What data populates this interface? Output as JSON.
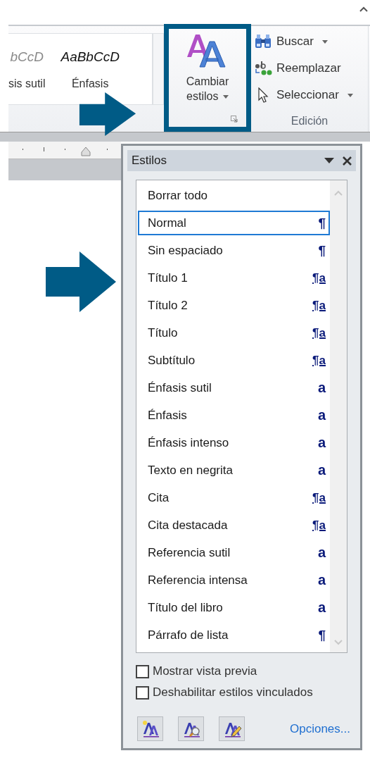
{
  "ribbon": {
    "gallery": [
      {
        "preview": "bCcD",
        "label": "sis sutil",
        "kind": "subtle"
      },
      {
        "preview": "AaBbCcD",
        "label": "Énfasis",
        "kind": "emphasis"
      }
    ],
    "change_styles": {
      "label": "Cambiar estilos",
      "highlighted": true
    },
    "editing": {
      "commands": [
        {
          "kind": "find",
          "label": "Buscar",
          "dropdown": true
        },
        {
          "kind": "replace",
          "label": "Reemplazar",
          "dropdown": false
        },
        {
          "kind": "select",
          "label": "Seleccionar",
          "dropdown": true
        }
      ],
      "group_label": "Edición"
    }
  },
  "styles_pane": {
    "title": "Estilos",
    "styles": [
      {
        "name": "Borrar todo",
        "selected": false
      },
      {
        "name": "Normal",
        "selected": true,
        "kind": "paragraph",
        "mark": "¶"
      },
      {
        "name": "Sin espaciado",
        "selected": false,
        "kind": "paragraph",
        "mark": "¶"
      },
      {
        "name": "Título 1",
        "selected": false,
        "kind": "linked",
        "mark": "¶a"
      },
      {
        "name": "Título 2",
        "selected": false,
        "kind": "linked",
        "mark": "¶a"
      },
      {
        "name": "Título",
        "selected": false,
        "kind": "linked",
        "mark": "¶a"
      },
      {
        "name": "Subtítulo",
        "selected": false,
        "kind": "linked",
        "mark": "¶a"
      },
      {
        "name": "Énfasis sutil",
        "selected": false,
        "kind": "character",
        "mark": "a"
      },
      {
        "name": "Énfasis",
        "selected": false,
        "kind": "character",
        "mark": "a"
      },
      {
        "name": "Énfasis intenso",
        "selected": false,
        "kind": "character",
        "mark": "a"
      },
      {
        "name": "Texto en negrita",
        "selected": false,
        "kind": "character",
        "mark": "a"
      },
      {
        "name": "Cita",
        "selected": false,
        "kind": "linked",
        "mark": "¶a"
      },
      {
        "name": "Cita destacada",
        "selected": false,
        "kind": "linked",
        "mark": "¶a"
      },
      {
        "name": "Referencia sutil",
        "selected": false,
        "kind": "character",
        "mark": "a"
      },
      {
        "name": "Referencia intensa",
        "selected": false,
        "kind": "character",
        "mark": "a"
      },
      {
        "name": "Título del libro",
        "selected": false,
        "kind": "character",
        "mark": "a"
      },
      {
        "name": "Párrafo de lista",
        "selected": false,
        "kind": "paragraph",
        "mark": "¶"
      }
    ],
    "options": [
      {
        "label": "Mostrar vista previa",
        "checked": false
      },
      {
        "label": "Deshabilitar estilos vinculados",
        "checked": false
      }
    ],
    "tool_buttons": [
      {
        "kind": "new"
      },
      {
        "kind": "inspect"
      },
      {
        "kind": "manage"
      }
    ],
    "options_link": "Opciones..."
  }
}
